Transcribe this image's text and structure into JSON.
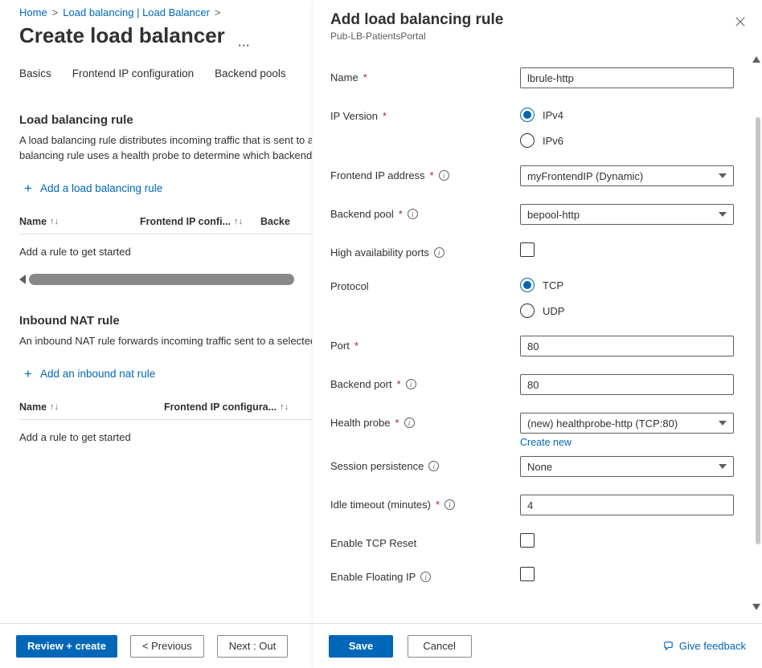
{
  "breadcrumb": {
    "home": "Home",
    "parent": "Load balancing | Load Balancer"
  },
  "page": {
    "title": "Create load balancer"
  },
  "tabs": {
    "basics": "Basics",
    "frontend": "Frontend IP configuration",
    "backend": "Backend pools"
  },
  "sections": {
    "lbrule": {
      "title": "Load balancing rule",
      "desc": "A load balancing rule distributes incoming traffic that is sent to a selected IP address and port combination across a group of backend pool instances. A load balancing rule uses a health probe to determine which backend instances are eligible to receive traffic.",
      "add": "Add a load balancing rule",
      "cols": {
        "name": "Name",
        "frontend": "Frontend IP confi...",
        "backend": "Backe"
      },
      "empty": "Add a rule to get started"
    },
    "nat": {
      "title": "Inbound NAT rule",
      "desc": "An inbound NAT rule forwards incoming traffic sent to a selected IP address and port combination to a specific virtual machine.",
      "add": "Add an inbound nat rule",
      "cols": {
        "name": "Name",
        "frontend": "Frontend IP configura..."
      },
      "empty": "Add a rule to get started"
    }
  },
  "footer": {
    "review": "Review + create",
    "prev": "< Previous",
    "next": "Next : Out"
  },
  "blade": {
    "title": "Add load balancing rule",
    "subtitle": "Pub-LB-PatientsPortal",
    "labels": {
      "name": "Name",
      "ipVersion": "IP Version",
      "frontendIp": "Frontend IP address",
      "backendPool": "Backend pool",
      "haPorts": "High availability ports",
      "protocol": "Protocol",
      "port": "Port",
      "backendPort": "Backend port",
      "healthProbe": "Health probe",
      "createNew": "Create new",
      "session": "Session persistence",
      "idle": "Idle timeout (minutes)",
      "tcpReset": "Enable TCP Reset",
      "floatingIp": "Enable Floating IP"
    },
    "values": {
      "name": "lbrule-http",
      "ipVersion": {
        "ipv4": "IPv4",
        "ipv6": "IPv6",
        "selected": "ipv4"
      },
      "frontendIp": "myFrontendIP (Dynamic)",
      "backendPool": "bepool-http",
      "protocol": {
        "tcp": "TCP",
        "udp": "UDP",
        "selected": "tcp"
      },
      "port": "80",
      "backendPort": "80",
      "healthProbe": "(new) healthprobe-http (TCP:80)",
      "session": "None",
      "idle": "4"
    },
    "buttons": {
      "save": "Save",
      "cancel": "Cancel",
      "feedback": "Give feedback"
    }
  }
}
